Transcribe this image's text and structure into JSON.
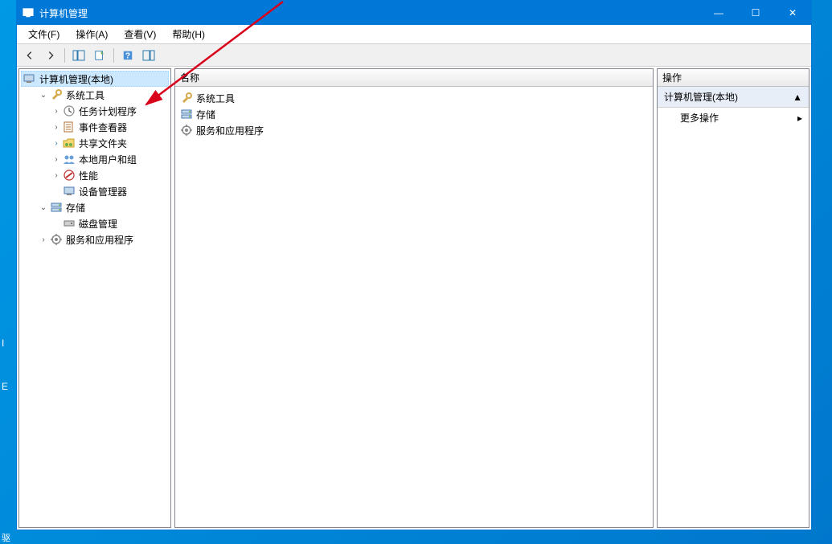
{
  "title": "计算机管理",
  "titlebar_buttons": {
    "min": "—",
    "max": "☐",
    "close": "✕"
  },
  "menubar": [
    {
      "label": "文件(F)"
    },
    {
      "label": "操作(A)"
    },
    {
      "label": "查看(V)"
    },
    {
      "label": "帮助(H)"
    }
  ],
  "toolbar": [
    {
      "name": "back-icon"
    },
    {
      "name": "forward-icon"
    },
    {
      "sep": true
    },
    {
      "name": "show-hide-tree-icon"
    },
    {
      "name": "export-list-icon"
    },
    {
      "sep": true
    },
    {
      "name": "help-icon"
    },
    {
      "name": "show-hide-action-icon"
    }
  ],
  "tree_root": {
    "icon": "computer-mgmt-icon",
    "label": "计算机管理(本地)",
    "selected": true
  },
  "tree": [
    {
      "depth": 1,
      "toggle": "expanded",
      "icon": "wrench-icon",
      "label": "系统工具"
    },
    {
      "depth": 2,
      "toggle": "collapsed",
      "icon": "clock-icon",
      "label": "任务计划程序"
    },
    {
      "depth": 2,
      "toggle": "collapsed",
      "icon": "event-icon",
      "label": "事件查看器"
    },
    {
      "depth": 2,
      "toggle": "collapsed",
      "icon": "shared-folder-icon",
      "label": "共享文件夹",
      "hl": true
    },
    {
      "depth": 2,
      "toggle": "collapsed",
      "icon": "users-icon",
      "label": "本地用户和组"
    },
    {
      "depth": 2,
      "toggle": "collapsed",
      "icon": "perf-icon",
      "label": "性能"
    },
    {
      "depth": 2,
      "toggle": "none",
      "icon": "device-icon",
      "label": "设备管理器"
    },
    {
      "depth": 1,
      "toggle": "expanded",
      "icon": "storage-icon",
      "label": "存储"
    },
    {
      "depth": 2,
      "toggle": "none",
      "icon": "disk-icon",
      "label": "磁盘管理"
    },
    {
      "depth": 1,
      "toggle": "collapsed",
      "icon": "services-icon",
      "label": "服务和应用程序"
    }
  ],
  "center_header": "名称",
  "center_list": [
    {
      "icon": "wrench-icon",
      "label": "系统工具"
    },
    {
      "icon": "storage-icon",
      "label": "存储"
    },
    {
      "icon": "services-icon",
      "label": "服务和应用程序"
    }
  ],
  "right_header": "操作",
  "actions_section": "计算机管理(本地)",
  "actions_more": "更多操作",
  "taskbar_hint": "驱",
  "desktop_label1": "I",
  "desktop_label2": "E"
}
